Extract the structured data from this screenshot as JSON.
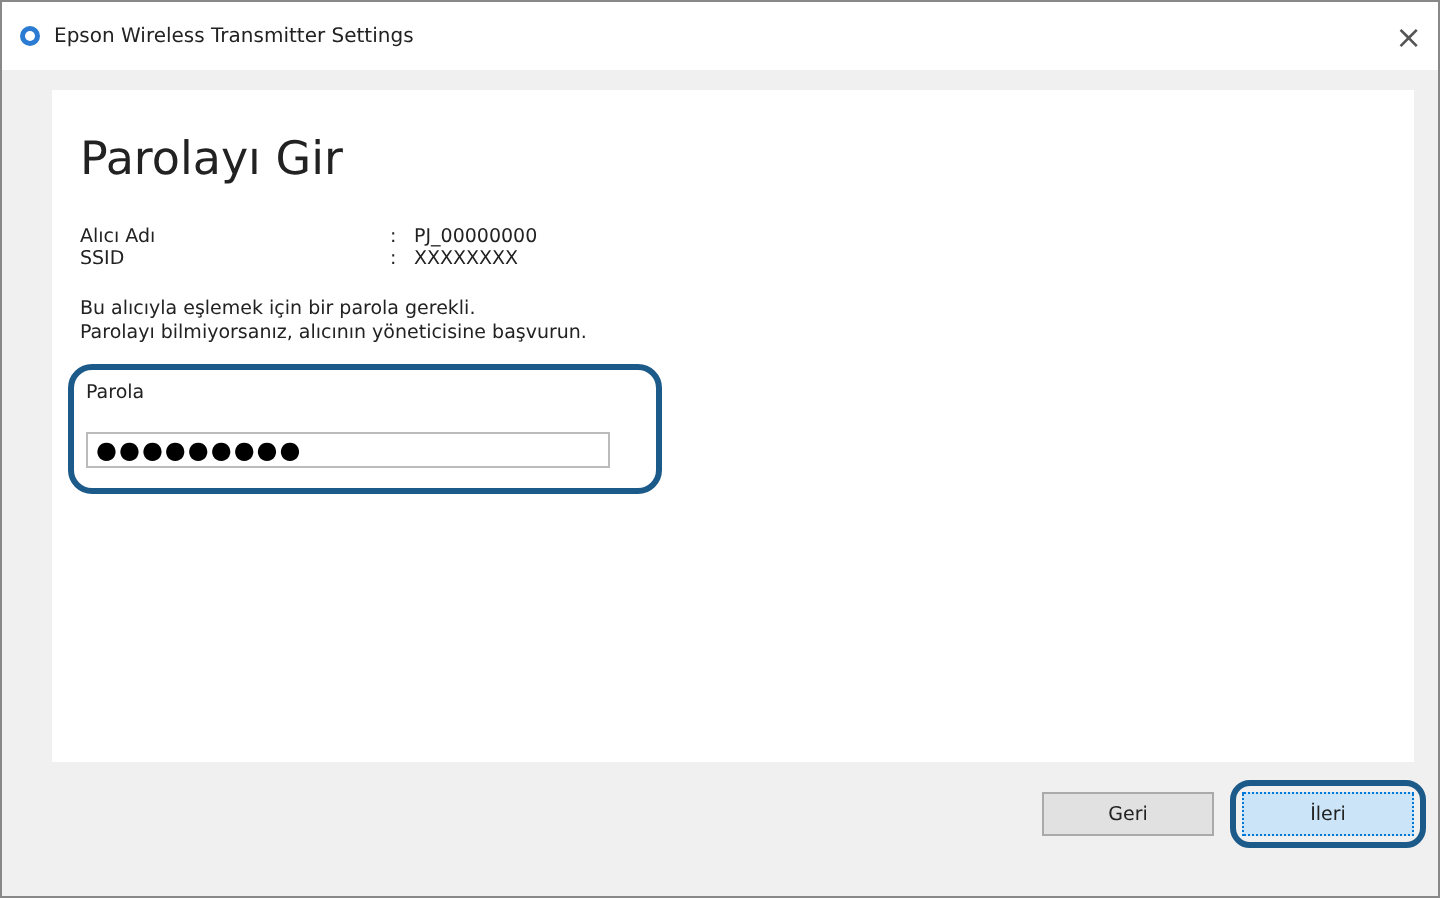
{
  "window": {
    "title": "Epson Wireless Transmitter Settings",
    "close": "×"
  },
  "heading": "Parolayı Gir",
  "info": [
    {
      "label": "Alıcı Adı",
      "separator": ":",
      "value": "PJ_00000000"
    },
    {
      "label": "SSID",
      "separator": ":",
      "value": "XXXXXXXX"
    }
  ],
  "message": [
    "Bu alıcıyla eşlemek için bir parola gerekli.",
    "Parolayı bilmiyorsanız, alıcının yöneticisine başvurun."
  ],
  "password": {
    "label": "Parola",
    "value": "●●●●●●●●●",
    "highlighted": true
  },
  "buttons": [
    {
      "label": "Geri",
      "kind": "secondary",
      "highlighted": false
    },
    {
      "label": "İleri",
      "kind": "primary",
      "highlighted": true
    }
  ]
}
